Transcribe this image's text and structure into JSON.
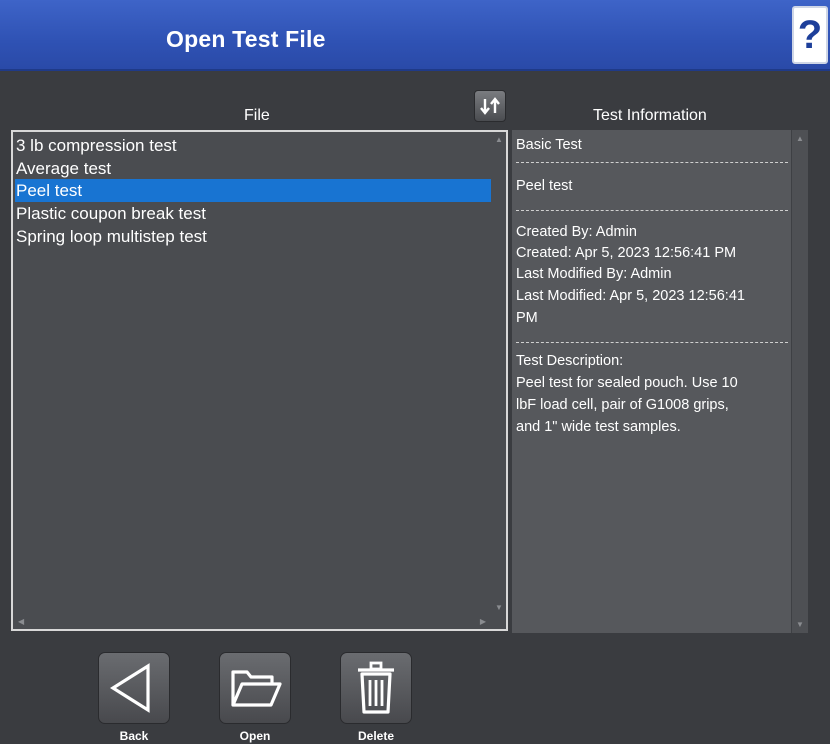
{
  "header": {
    "title": "Open Test File",
    "help_label": "?"
  },
  "file_panel": {
    "heading": "File",
    "items": [
      "3 lb compression test",
      "Average test",
      "Peel test",
      "Plastic coupon break test",
      "Spring loop multistep test"
    ],
    "selected_item": "Peel test"
  },
  "info_panel": {
    "heading": "Test Information",
    "type": "Basic Test",
    "name": "Peel test",
    "created_by": "Created By: Admin",
    "created": "Created: Apr 5, 2023 12:56:41 PM",
    "modified_by": "Last Modified By: Admin",
    "modified_1": "Last Modified: Apr 5, 2023 12:56:41",
    "modified_2": "PM",
    "desc_heading": "Test Description:",
    "desc_1": "Peel test for sealed pouch. Use 10",
    "desc_2": "lbF load cell, pair of G1008 grips,",
    "desc_3": "and 1\" wide test samples."
  },
  "toolbar": {
    "back_label": "Back",
    "open_label": "Open",
    "delete_label": "Delete"
  },
  "icons": {
    "sort": "sort-icon",
    "back": "back-arrow-icon",
    "open": "folder-open-icon",
    "delete": "trash-icon",
    "help": "help-icon"
  },
  "colors": {
    "title_bar": "#2f52b4",
    "selection": "#1874d2",
    "background": "#3a3c40"
  }
}
